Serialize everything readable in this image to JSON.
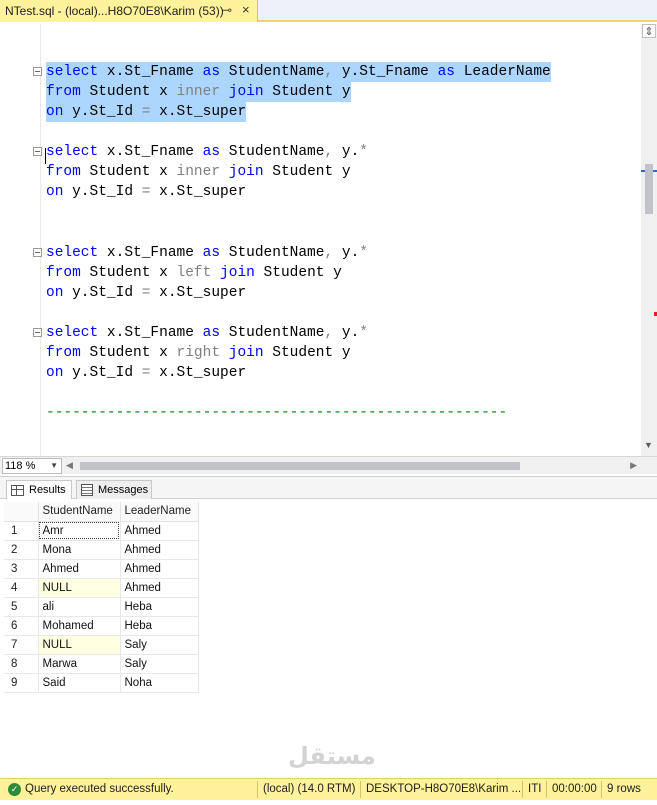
{
  "tab": {
    "title": "NTest.sql - (local)...H8O70E8\\Karim (53))",
    "pin_icon": "pin-icon",
    "close_icon": "close-icon"
  },
  "editor": {
    "blocks": [
      {
        "l1": [
          "select",
          " x.St_Fname ",
          "as",
          " StudentName",
          ",",
          " y.St_Fname ",
          "as",
          " LeaderName"
        ],
        "l2": [
          "from",
          " Student x ",
          "inner",
          " ",
          "join",
          " Student y"
        ],
        "l3": [
          "on",
          " y.St_Id ",
          "=",
          " x.St_super"
        ]
      },
      {
        "l1": [
          "select",
          " x.St_Fname ",
          "as",
          " StudentName",
          ",",
          " y.",
          "*"
        ],
        "l2": [
          "from",
          " Student x ",
          "inner",
          " ",
          "join",
          " Student y"
        ],
        "l3": [
          "on",
          " y.St_Id ",
          "=",
          " x.St_super"
        ]
      },
      {
        "l1": [
          "select",
          " x.St_Fname ",
          "as",
          " StudentName",
          ",",
          " y.",
          "*"
        ],
        "l2": [
          "from",
          " Student x ",
          "left",
          " ",
          "join",
          " Student y"
        ],
        "l3": [
          "on",
          " y.St_Id ",
          "=",
          " x.St_super"
        ]
      },
      {
        "l1": [
          "select",
          " x.St_Fname ",
          "as",
          " StudentName",
          ",",
          " y.",
          "*"
        ],
        "l2": [
          "from",
          " Student x ",
          "right",
          " ",
          "join",
          " Student y"
        ],
        "l3": [
          "on",
          " y.St_Id ",
          "=",
          " x.St_super"
        ]
      }
    ],
    "comment": "-----------------------------------------------------"
  },
  "zoom": "118 %",
  "results": {
    "tabs": {
      "results": "Results",
      "messages": "Messages"
    },
    "columns": [
      "StudentName",
      "LeaderName"
    ],
    "rows": [
      {
        "n": "1",
        "student": "Amr",
        "leader": "Ahmed"
      },
      {
        "n": "2",
        "student": "Mona",
        "leader": "Ahmed"
      },
      {
        "n": "3",
        "student": "Ahmed",
        "leader": "Ahmed"
      },
      {
        "n": "4",
        "student": "NULL",
        "leader": "Ahmed"
      },
      {
        "n": "5",
        "student": "ali",
        "leader": "Heba"
      },
      {
        "n": "6",
        "student": "Mohamed",
        "leader": "Heba"
      },
      {
        "n": "7",
        "student": "NULL",
        "leader": "Saly"
      },
      {
        "n": "8",
        "student": "Marwa",
        "leader": "Saly"
      },
      {
        "n": "9",
        "student": "Said",
        "leader": "Noha"
      }
    ]
  },
  "status": {
    "message": "Query executed successfully.",
    "server": "(local) (14.0 RTM)",
    "connection": "DESKTOP-H8O70E8\\Karim ...",
    "db": "ITI",
    "time": "00:00:00",
    "rows": "9 rows"
  },
  "watermark": "مستقل",
  "colors": {
    "status_bar": "#fff29d",
    "selection": "#add6ff",
    "keyword": "#0000ff",
    "comment": "#008000"
  }
}
